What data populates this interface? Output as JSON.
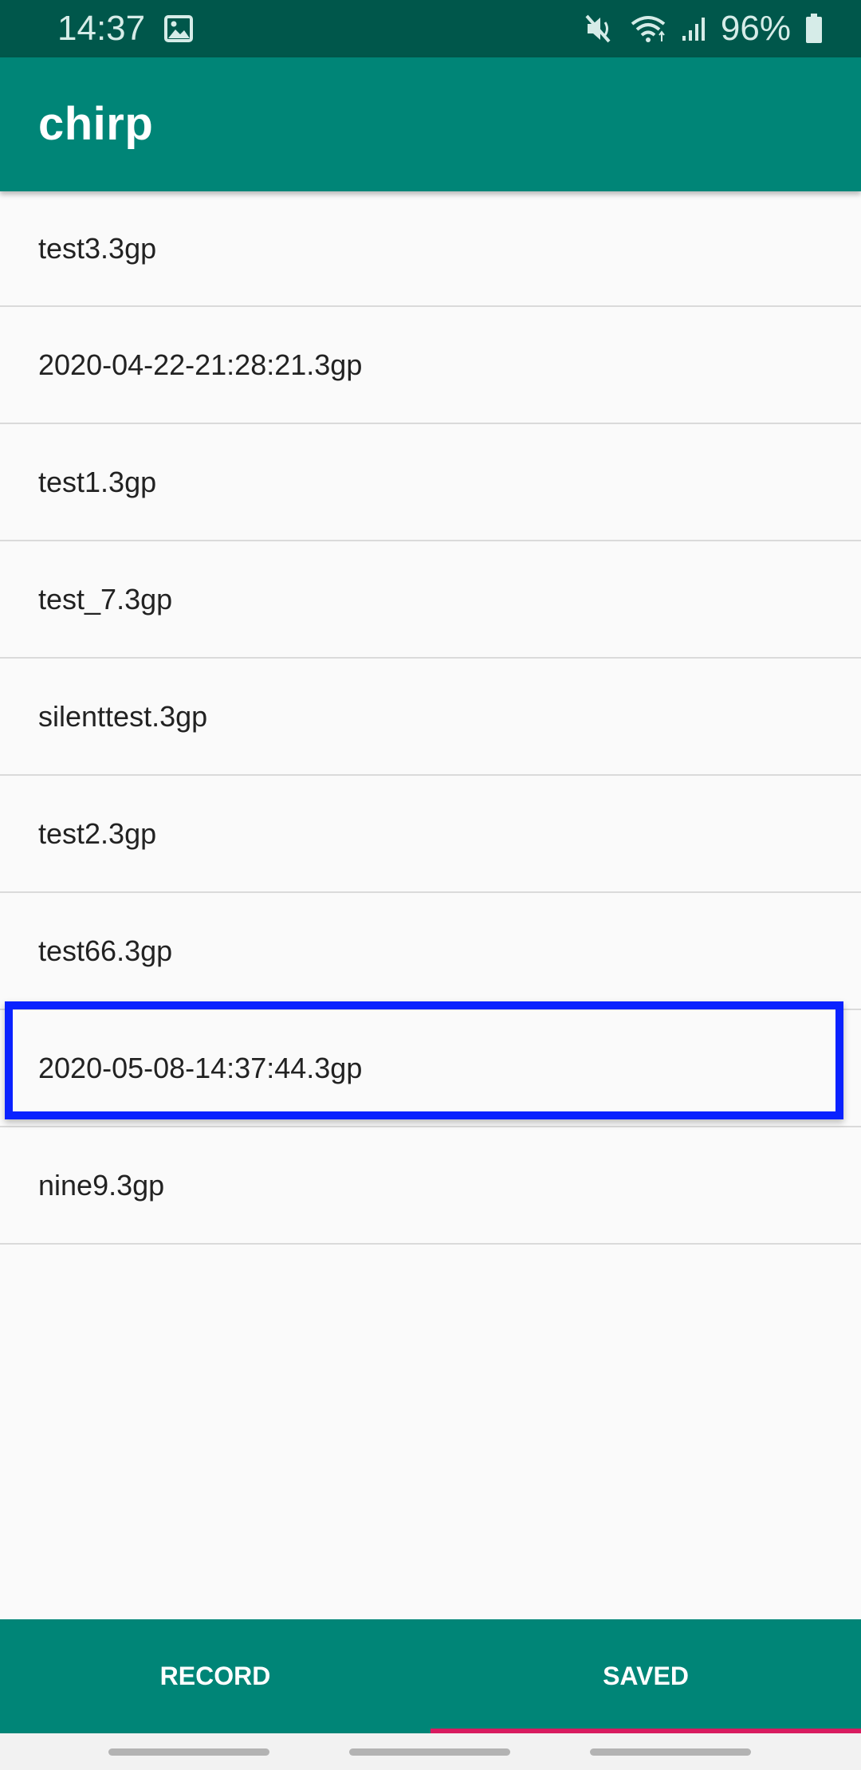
{
  "status_bar": {
    "time": "14:37",
    "battery": "96%",
    "icons": [
      "image-icon",
      "mute-icon",
      "wifi-icon",
      "signal-icon",
      "battery-icon"
    ]
  },
  "app_bar": {
    "title": "chirp"
  },
  "file_list": {
    "items": [
      "test3.3gp",
      "2020-04-22-21:28:21.3gp",
      "test1.3gp",
      "test_7.3gp",
      "silenttest.3gp",
      "test2.3gp",
      "test66.3gp",
      "2020-05-08-14:37:44.3gp",
      "nine9.3gp"
    ],
    "highlighted_index": 7
  },
  "tabs": {
    "record_label": "RECORD",
    "saved_label": "SAVED",
    "selected": "SAVED"
  },
  "colors": {
    "status_bar": "#00574b",
    "app_bar": "#008577",
    "tab_indicator": "#d81b60",
    "highlight": "#0a22ff",
    "background": "#fafafa"
  }
}
